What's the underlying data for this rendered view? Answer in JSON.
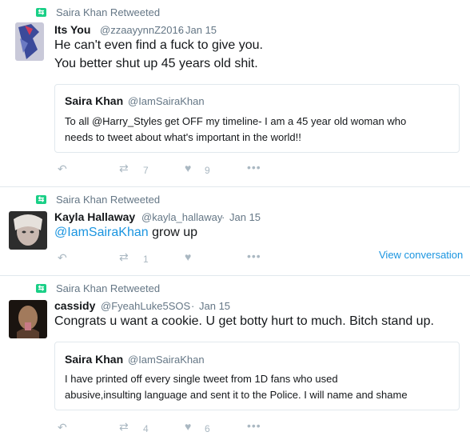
{
  "tweets": [
    {
      "retweeted_by": "Saira Khan Retweeted",
      "name": "Its You",
      "handle": "@zzaayynnZ2016",
      "dot": "·",
      "date": "Jan 15",
      "line1": "He can't even find a fuck to give you.",
      "line2": "You better shut up 45 years old shit.",
      "quote": {
        "name": "Saira Khan",
        "handle": "@IamSairaKhan",
        "line1": "To all @Harry_Styles get OFF my timeline- I am a 45 year old woman who",
        "line2": "needs to tweet about what's important in the world!!"
      },
      "retweets": "7",
      "likes": "9"
    },
    {
      "retweeted_by": "Saira Khan Retweeted",
      "name": "Kayla Hallaway",
      "handle": "@kayla_hallaway",
      "dot": "·",
      "date": "Jan 15",
      "mention": "@IamSairaKhan",
      "text": " grow up",
      "retweets": "1",
      "view_conversation": "View conversation"
    },
    {
      "retweeted_by": "Saira Khan Retweeted",
      "name": "cassidy",
      "handle": "@FyeahLuke5SOS",
      "dot": "·",
      "date": "Jan 15",
      "text": "Congrats u want a cookie. U get botty hurt to much. Bitch stand up.",
      "quote": {
        "name": "Saira Khan",
        "handle": "@IamSairaKhan",
        "line1": "I have printed off every single tweet from 1D fans who used",
        "line2": "abusive,insulting language and sent it to the Police. I will name and shame"
      },
      "retweets": "4",
      "likes": "6"
    }
  ],
  "icons": {
    "retweet_badge": "retweet-badge-icon",
    "reply": "reply-icon",
    "retweet": "retweet-icon",
    "like": "heart-icon",
    "more": "more-icon"
  }
}
